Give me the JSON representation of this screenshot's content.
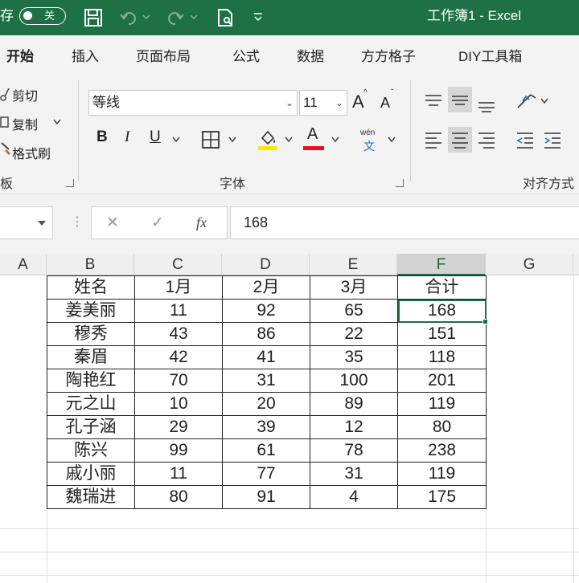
{
  "titlebar": {
    "save_label": "存",
    "autosave_state": "关",
    "title": "工作簿1  -  Excel",
    "colors": {
      "bar": "#1e7145",
      "text": "#ffffff"
    },
    "icons": [
      "save-icon",
      "undo-icon",
      "redo-icon",
      "print-preview-icon",
      "customize-qat-icon"
    ]
  },
  "ribbon_tabs": [
    {
      "label": "开始",
      "active": true
    },
    {
      "label": "插入"
    },
    {
      "label": "页面布局"
    },
    {
      "label": "公式"
    },
    {
      "label": "数据"
    },
    {
      "label": "方方格子"
    },
    {
      "label": "DIY工具箱"
    }
  ],
  "clipboard": {
    "cut": "剪切",
    "copy": "复制",
    "format_painter": "格式刷",
    "group": "板"
  },
  "font": {
    "name": "等线",
    "size": "11",
    "grow": "A",
    "shrink": "A",
    "bold": "B",
    "italic": "I",
    "underline": "U",
    "font_color_glyph": "A",
    "phonetic_top": "wén",
    "phonetic_bottom": "文",
    "group": "字体",
    "fill_color": "#ffe600",
    "font_color": "#e81123"
  },
  "alignment": {
    "group": "对齐方式"
  },
  "formula_bar": {
    "cancel": "✕",
    "enter": "✓",
    "fx": "fx",
    "value": "168"
  },
  "sheet": {
    "columns": [
      "A",
      "B",
      "C",
      "D",
      "E",
      "F",
      "G"
    ],
    "selected_column": "F",
    "header": [
      "姓名",
      "1月",
      "2月",
      "3月",
      "合计"
    ],
    "rows": [
      [
        "姜美丽",
        "11",
        "92",
        "65",
        "168"
      ],
      [
        "穆秀",
        "43",
        "86",
        "22",
        "151"
      ],
      [
        "秦眉",
        "42",
        "41",
        "35",
        "118"
      ],
      [
        "陶艳红",
        "70",
        "31",
        "100",
        "201"
      ],
      [
        "元之山",
        "10",
        "20",
        "89",
        "119"
      ],
      [
        "孔子涵",
        "29",
        "39",
        "12",
        "80"
      ],
      [
        "陈兴",
        "99",
        "61",
        "78",
        "238"
      ],
      [
        "戚小丽",
        "11",
        "77",
        "31",
        "119"
      ],
      [
        "魏瑞进",
        "80",
        "91",
        "4",
        "175"
      ]
    ],
    "active_cell": "F2",
    "accent": "#1e7145"
  }
}
